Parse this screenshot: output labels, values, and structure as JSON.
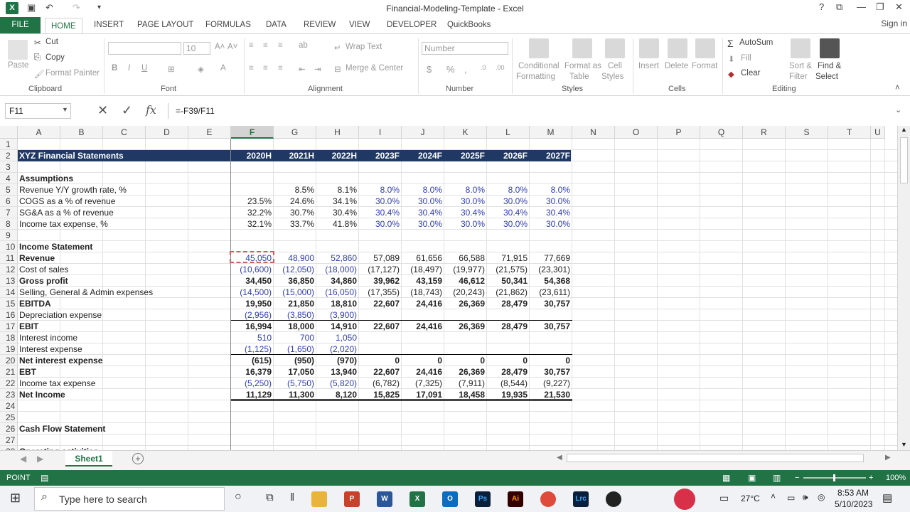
{
  "titlebar": {
    "title": "Financial-Modeling-Template - Excel",
    "app_icon": "X",
    "undo_icon": "↶",
    "redo_icon": "↷",
    "help_icon": "?"
  },
  "tabs": {
    "file": "FILE",
    "items": [
      "HOME",
      "INSERT",
      "PAGE LAYOUT",
      "FORMULAS",
      "DATA",
      "REVIEW",
      "VIEW",
      "DEVELOPER",
      "QuickBooks"
    ],
    "active": "HOME",
    "signin": "Sign in"
  },
  "ribbon": {
    "clipboard": {
      "paste": "Paste",
      "cut": "Cut",
      "copy": "Copy",
      "format_painter": "Format Painter",
      "group": "Clipboard"
    },
    "font": {
      "size": "10",
      "bold": "B",
      "italic": "I",
      "underline": "U",
      "group": "Font",
      "grow": "A˄",
      "shrink": "A˅"
    },
    "alignment": {
      "wrap_text": "Wrap Text",
      "merge_center": "Merge & Center",
      "group": "Alignment"
    },
    "number": {
      "format": "Number",
      "currency": "$",
      "percent": "%",
      "comma": ",",
      "group": "Number"
    },
    "styles": {
      "conditional": "Conditional",
      "conditional2": "Formatting",
      "format_as": "Format as",
      "format_as2": "Table",
      "cell": "Cell",
      "cell2": "Styles",
      "group": "Styles"
    },
    "cells": {
      "insert": "Insert",
      "delete": "Delete",
      "format": "Format",
      "group": "Cells"
    },
    "editing": {
      "autosum": "AutoSum",
      "fill": "Fill",
      "clear": "Clear",
      "sort": "Sort &",
      "sort2": "Filter",
      "find": "Find &",
      "find2": "Select",
      "group": "Editing"
    }
  },
  "formula_bar": {
    "name_box": "F11",
    "formula": "=-F39/F11",
    "fx": "fx",
    "cancel": "✕",
    "enter": "✓"
  },
  "columns": [
    "A",
    "B",
    "C",
    "D",
    "E",
    "F",
    "G",
    "H",
    "I",
    "J",
    "K",
    "L",
    "M",
    "N",
    "O",
    "P",
    "Q",
    "R",
    "S",
    "T",
    "U"
  ],
  "selected_column": "F",
  "row_numbers": [
    "1",
    "2",
    "3",
    "4",
    "5",
    "6",
    "7",
    "8",
    "9",
    "10",
    "11",
    "12",
    "13",
    "14",
    "15",
    "16",
    "17",
    "18",
    "19",
    "20",
    "21",
    "22",
    "23",
    "24",
    "25",
    "26",
    "27",
    "28"
  ],
  "year_headers": [
    "2020H",
    "2021H",
    "2022H",
    "2023F",
    "2024F",
    "2025F",
    "2026F",
    "2027F"
  ],
  "sheet_title": "XYZ Financial Statements",
  "rows": [
    {
      "r": 4,
      "label": "Assumptions",
      "bold": true,
      "vals": []
    },
    {
      "r": 5,
      "label": "Revenue Y/Y growth rate, %",
      "vals": [
        "",
        "8.5%",
        "8.1%",
        "8.0%",
        "8.0%",
        "8.0%",
        "8.0%",
        "8.0%"
      ],
      "blue_from": 3
    },
    {
      "r": 6,
      "label": "COGS as a % of revenue",
      "vals": [
        "23.5%",
        "24.6%",
        "34.1%",
        "30.0%",
        "30.0%",
        "30.0%",
        "30.0%",
        "30.0%"
      ],
      "blue_from": 3
    },
    {
      "r": 7,
      "label": "SG&A as a % of revenue",
      "vals": [
        "32.2%",
        "30.7%",
        "30.4%",
        "30.4%",
        "30.4%",
        "30.4%",
        "30.4%",
        "30.4%"
      ],
      "blue_from": 3
    },
    {
      "r": 8,
      "label": "Income tax expense, %",
      "vals": [
        "32.1%",
        "33.7%",
        "41.8%",
        "30.0%",
        "30.0%",
        "30.0%",
        "30.0%",
        "30.0%"
      ],
      "blue_from": 3
    },
    {
      "r": 10,
      "label": "Income Statement",
      "bold": true,
      "vals": []
    },
    {
      "r": 11,
      "label": "Revenue",
      "bold": true,
      "vals": [
        "45,050",
        "48,900",
        "52,860",
        "57,089",
        "61,656",
        "66,588",
        "71,915",
        "77,669"
      ],
      "blue_to": 3,
      "nobold_vals": true
    },
    {
      "r": 12,
      "label": "Cost of sales",
      "vals": [
        "(10,600)",
        "(12,050)",
        "(18,000)",
        "(17,127)",
        "(18,497)",
        "(19,977)",
        "(21,575)",
        "(23,301)"
      ],
      "blue_to": 3
    },
    {
      "r": 13,
      "label": "Gross profit",
      "bold": true,
      "vals": [
        "34,450",
        "36,850",
        "34,860",
        "39,962",
        "43,159",
        "46,612",
        "50,341",
        "54,368"
      ]
    },
    {
      "r": 14,
      "label": "Selling, General & Admin expenses",
      "vals": [
        "(14,500)",
        "(15,000)",
        "(16,050)",
        "(17,355)",
        "(18,743)",
        "(20,243)",
        "(21,862)",
        "(23,611)"
      ],
      "blue_to": 3
    },
    {
      "r": 15,
      "label": "EBITDA",
      "bold": true,
      "vals": [
        "19,950",
        "21,850",
        "18,810",
        "22,607",
        "24,416",
        "26,369",
        "28,479",
        "30,757"
      ]
    },
    {
      "r": 16,
      "label": "Depreciation expense",
      "vals": [
        "(2,956)",
        "(3,850)",
        "(3,900)",
        "",
        "",
        "",
        "",
        ""
      ],
      "blue_to": 3
    },
    {
      "r": 17,
      "label": "EBIT",
      "bold": true,
      "vals": [
        "16,994",
        "18,000",
        "14,910",
        "22,607",
        "24,416",
        "26,369",
        "28,479",
        "30,757"
      ]
    },
    {
      "r": 18,
      "label": "Interest income",
      "vals": [
        "510",
        "700",
        "1,050",
        "",
        "",
        "",
        "",
        ""
      ],
      "blue_to": 3
    },
    {
      "r": 19,
      "label": "Interest expense",
      "vals": [
        "(1,125)",
        "(1,650)",
        "(2,020)",
        "",
        "",
        "",
        "",
        ""
      ],
      "blue_to": 3
    },
    {
      "r": 20,
      "label": "Net interest expense",
      "bold": true,
      "vals": [
        "(615)",
        "(950)",
        "(970)",
        "0",
        "0",
        "0",
        "0",
        "0"
      ]
    },
    {
      "r": 21,
      "label": "EBT",
      "bold": true,
      "vals": [
        "16,379",
        "17,050",
        "13,940",
        "22,607",
        "24,416",
        "26,369",
        "28,479",
        "30,757"
      ]
    },
    {
      "r": 22,
      "label": "Income tax expense",
      "vals": [
        "(5,250)",
        "(5,750)",
        "(5,820)",
        "(6,782)",
        "(7,325)",
        "(7,911)",
        "(8,544)",
        "(9,227)"
      ],
      "blue_to": 3
    },
    {
      "r": 23,
      "label": "Net Income",
      "bold": true,
      "vals": [
        "11,129",
        "11,300",
        "8,120",
        "15,825",
        "17,091",
        "18,458",
        "19,935",
        "21,530"
      ]
    },
    {
      "r": 26,
      "label": "Cash Flow Statement",
      "bold": true,
      "vals": []
    },
    {
      "r": 28,
      "label": "Operating activities",
      "bold": true,
      "vals": []
    }
  ],
  "sheet_tabs": {
    "active": "Sheet1",
    "add": "+"
  },
  "status": {
    "mode": "POINT",
    "zoom": "100%"
  },
  "taskbar": {
    "search_placeholder": "Type here to search",
    "temp": "27°C",
    "time": "8:53 AM",
    "date": "5/10/2023"
  },
  "colors": {
    "excel_green": "#217346",
    "header_band": "#1f3864",
    "input_blue": "#2f3db0"
  }
}
